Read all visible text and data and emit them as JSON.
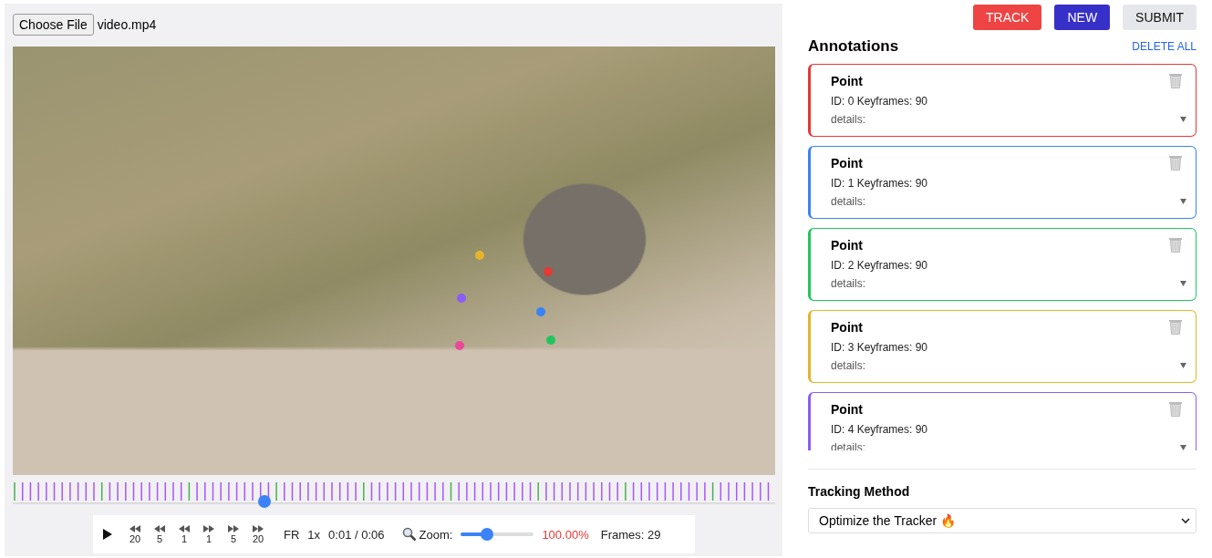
{
  "file_input": {
    "button": "Choose File",
    "filename": "video.mp4"
  },
  "video": {
    "points": [
      {
        "color": "#e5b52a"
      },
      {
        "color": "#e53935"
      },
      {
        "color": "#8b5cf6"
      },
      {
        "color": "#3b82f6"
      },
      {
        "color": "#ec4899"
      },
      {
        "color": "#22c55e"
      }
    ]
  },
  "timeline": {
    "level": 0.33
  },
  "controls": {
    "steps": [
      {
        "kind": "back",
        "label": "20"
      },
      {
        "kind": "back",
        "label": "5"
      },
      {
        "kind": "back",
        "label": "1"
      },
      {
        "kind": "forward",
        "label": "1"
      },
      {
        "kind": "forward",
        "label": "5"
      },
      {
        "kind": "forward",
        "label": "20"
      }
    ],
    "frame_rate": "FR",
    "speed": "1x",
    "time": "0:01 / 0:06",
    "zoom_label": "Zoom:",
    "zoom": {
      "level": 0.36
    },
    "zoom_value": "100.00%",
    "frames": "Frames: 29"
  },
  "actions": [
    {
      "kind": "danger",
      "label": "TRACK"
    },
    {
      "kind": "primary",
      "label": "NEW"
    },
    {
      "kind": "plain",
      "label": "SUBMIT"
    }
  ],
  "annotations": {
    "title": "Annotations",
    "delete_all": "DELETE ALL",
    "items": [
      {
        "title": "Point",
        "info": "ID: 0 Keyframes: 90",
        "details": "details:",
        "color": "#e53935"
      },
      {
        "title": "Point",
        "info": "ID: 1 Keyframes: 90",
        "details": "details:",
        "color": "#3b82f6"
      },
      {
        "title": "Point",
        "info": "ID: 2 Keyframes: 90",
        "details": "details:",
        "color": "#22c55e"
      },
      {
        "title": "Point",
        "info": "ID: 3 Keyframes: 90",
        "details": "details:",
        "color": "#e5b52a"
      },
      {
        "title": "Point",
        "info": "ID: 4 Keyframes: 90",
        "details": "details:",
        "color": "#8b5cf6"
      }
    ]
  },
  "tracking": {
    "label": "Tracking Method",
    "value": "Optimize the Tracker 🔥"
  }
}
